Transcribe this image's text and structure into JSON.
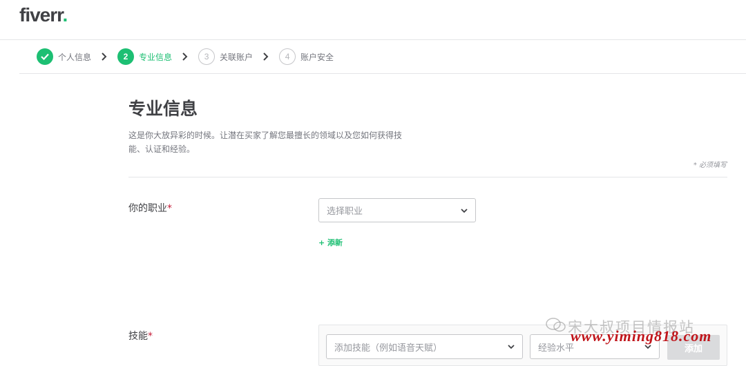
{
  "header": {
    "logo_text": "fiverr",
    "logo_dot": "."
  },
  "steps": [
    {
      "number": "1",
      "label": "个人信息",
      "state": "completed",
      "icon": "check-icon"
    },
    {
      "number": "2",
      "label": "专业信息",
      "state": "active"
    },
    {
      "number": "3",
      "label": "关联账户",
      "state": "upcoming"
    },
    {
      "number": "4",
      "label": "账户安全",
      "state": "upcoming"
    }
  ],
  "page": {
    "title": "专业信息",
    "description": "这是你大放异彩的时候。让潜在买家了解您最擅长的领域以及您如何获得技能、认证和经验。",
    "required_note": "* 必须填写"
  },
  "occupation": {
    "label": "你的职业",
    "required_mark": "*",
    "select_placeholder": "选择职业",
    "add_link": "+ 添新"
  },
  "skills": {
    "label": "技能",
    "required_mark": "*",
    "skill_placeholder": "添加技能（例如语音天赋）",
    "level_placeholder": "经验水平",
    "add_button": "添加"
  },
  "watermark": {
    "line1": "宋大叔项目情报站",
    "line2": "www.yiming818.com"
  },
  "colors": {
    "brand_green": "#1dbf73",
    "required_red": "#c51e3a",
    "watermark_red": "#c0151b"
  }
}
